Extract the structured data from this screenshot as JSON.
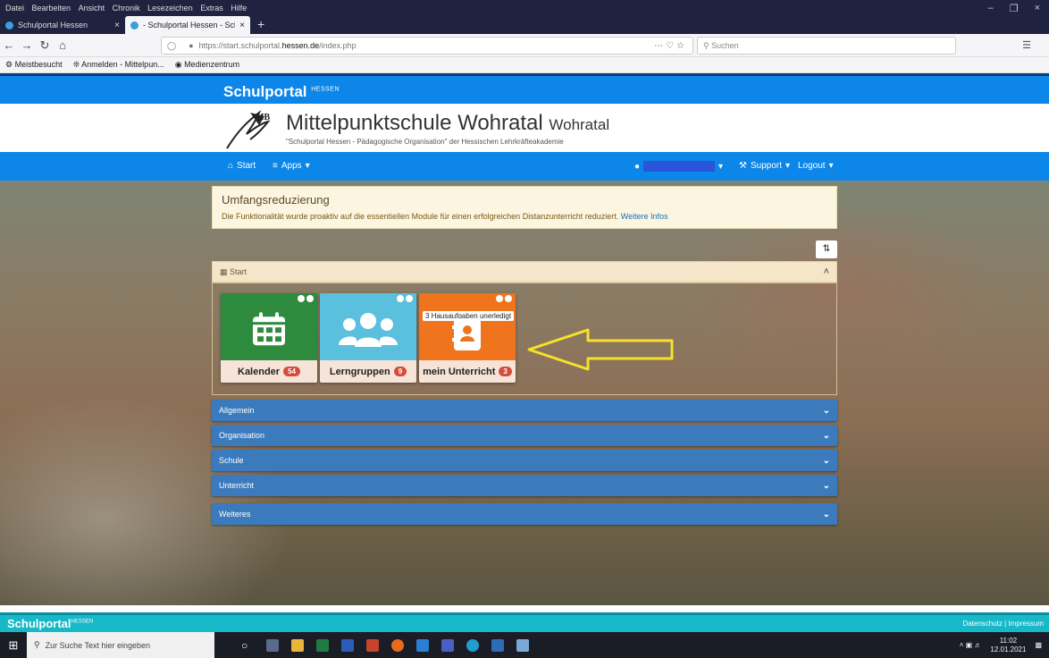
{
  "browser": {
    "menu": [
      "Datei",
      "Bearbeiten",
      "Ansicht",
      "Chronik",
      "Lesezeichen",
      "Extras",
      "Hilfe"
    ],
    "tabs": [
      {
        "title": "Schulportal Hessen"
      },
      {
        "title": "- Schulportal Hessen - Schulpo"
      }
    ],
    "url_prefix": "https://start.schulportal.",
    "url_host": "hessen.de",
    "url_suffix": "/index.php",
    "search_placeholder": "Suchen",
    "bookmarks": [
      "Meistbesucht",
      "Anmelden - Mittelpun...",
      "Medienzentrum"
    ]
  },
  "site": {
    "brand": "Schulportal",
    "brand_sup": "HESSEN",
    "school_name": "Mittelpunktschule Wohratal",
    "school_sub": "Wohratal",
    "tagline": "\"Schulportal Hessen - Pädagogische Organisation\" der Hessischen Lehrkräfteakademie"
  },
  "nav": {
    "start": "Start",
    "apps": "Apps",
    "support": "Support",
    "logout": "Logout"
  },
  "notice": {
    "title": "Umfangsreduzierung",
    "text": "Die Funktionalität wurde proaktiv auf die essentiellen Module für einen erfolgreichen Distanzunterricht reduziert.",
    "link": "Weitere Infos"
  },
  "start_section": {
    "label": "Start",
    "tiles": [
      {
        "label": "Kalender",
        "badge": "54",
        "color": "#2e8b3e"
      },
      {
        "label": "Lerngruppen",
        "badge": "9",
        "color": "#5bc0de"
      },
      {
        "label": "mein Unterricht",
        "badge": "3",
        "color": "#f0741e",
        "note": "3 Hausaufgaben unerledigt"
      }
    ]
  },
  "accordion": [
    "Allgemein",
    "Organisation",
    "Schule",
    "Unterricht",
    "Weiteres"
  ],
  "footer": {
    "brand": "Schulportal",
    "brand_sup": "HESSEN",
    "links": "Datenschutz | Impressum"
  },
  "taskbar": {
    "search": "Zur Suche Text hier eingeben",
    "time": "11:02",
    "date": "12.01.2021"
  }
}
